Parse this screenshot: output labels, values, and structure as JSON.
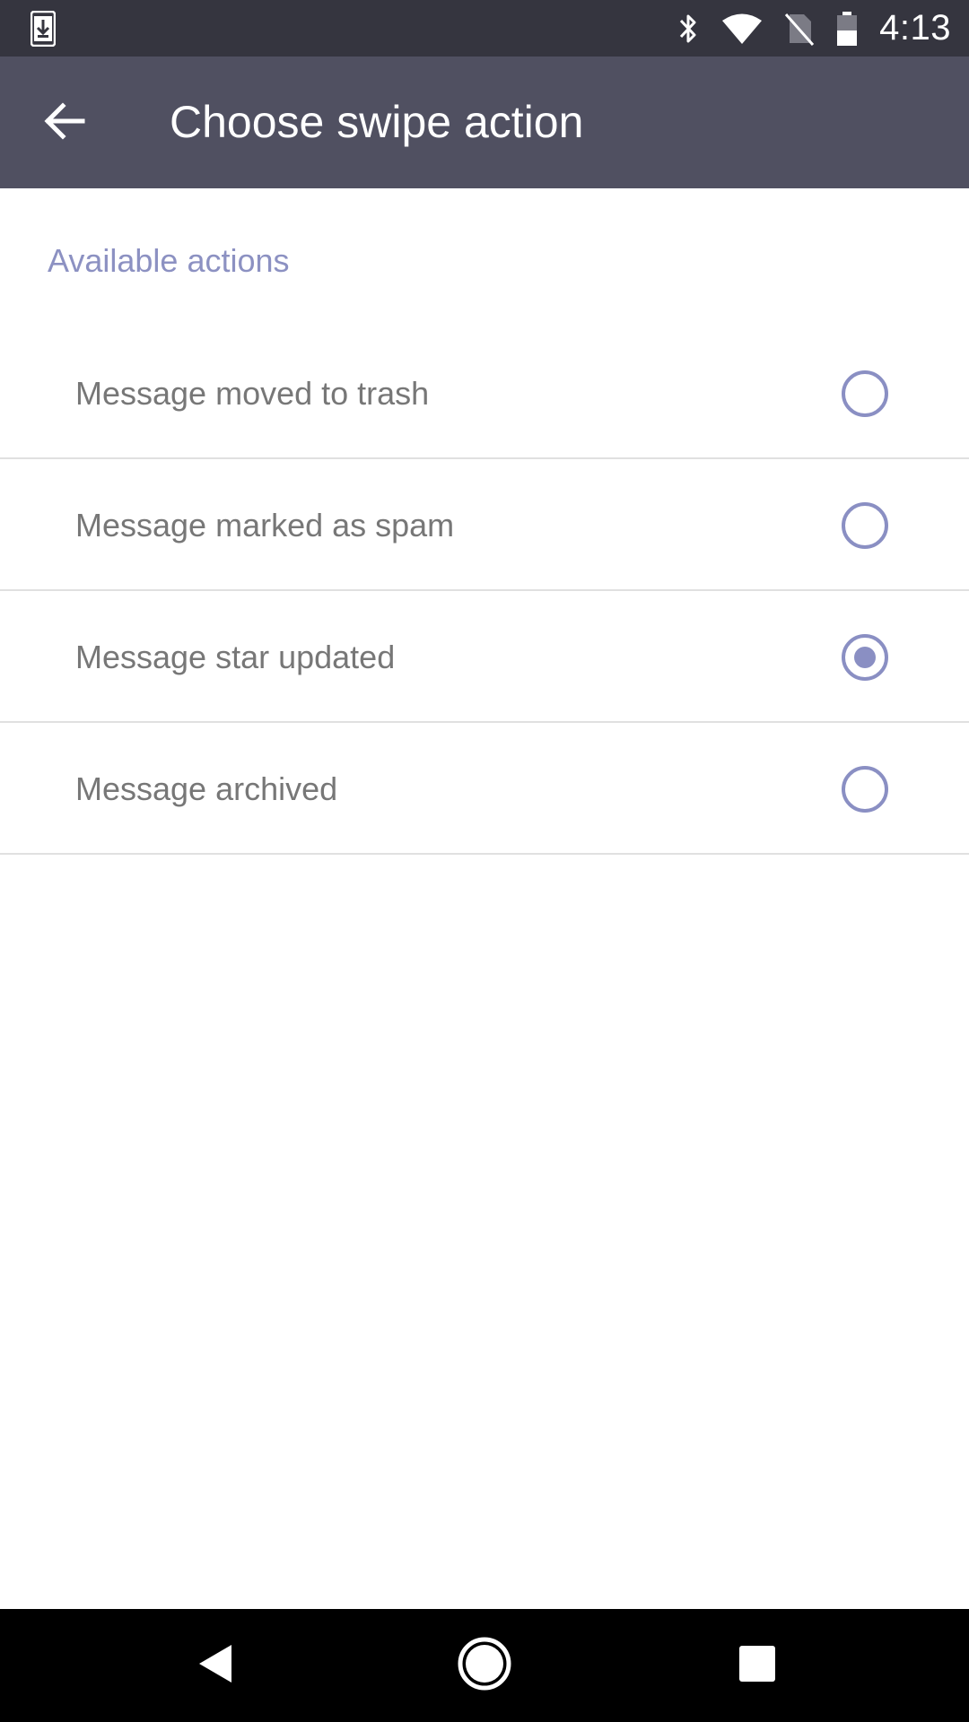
{
  "status_bar": {
    "time": "4:13",
    "icons": [
      "download-icon",
      "bluetooth-icon",
      "wifi-icon",
      "no-sim-icon",
      "battery-icon"
    ]
  },
  "toolbar": {
    "title": "Choose swipe action",
    "back_icon": "arrow-left-icon"
  },
  "section": {
    "header": "Available actions"
  },
  "options": [
    {
      "label": "Message moved to trash",
      "selected": false
    },
    {
      "label": "Message marked as spam",
      "selected": false
    },
    {
      "label": "Message star updated",
      "selected": true
    },
    {
      "label": "Message archived",
      "selected": false
    }
  ],
  "nav_bar": {
    "icons": [
      "back-triangle-icon",
      "home-circle-icon",
      "recents-square-icon"
    ]
  },
  "colors": {
    "status_bar": "#35353f",
    "toolbar": "#505061",
    "accent": "#8a8fc3",
    "section_header": "#8c91c2",
    "option_text": "#777777",
    "divider": "#e0e0e0"
  }
}
